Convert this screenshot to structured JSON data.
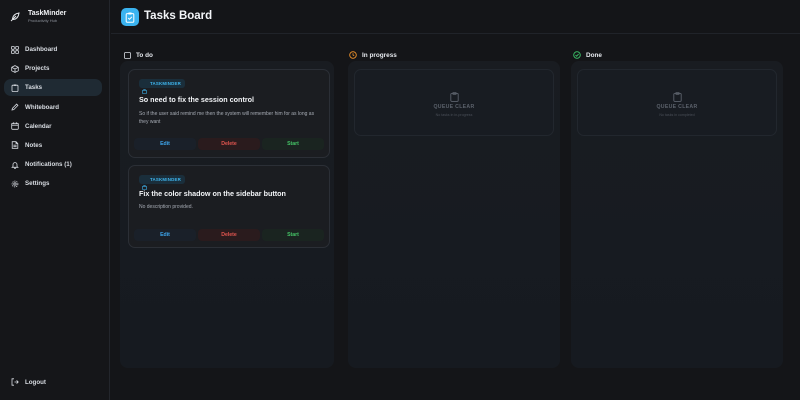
{
  "brand": {
    "name": "TaskMinder",
    "subtitle": "Productivity Hub",
    "logo_icon": "feather-icon"
  },
  "sidebar": {
    "items": [
      {
        "label": "Dashboard",
        "icon": "grid-icon"
      },
      {
        "label": "Projects",
        "icon": "box-icon"
      },
      {
        "label": "Tasks",
        "icon": "clipboard-icon",
        "active": true
      },
      {
        "label": "Whiteboard",
        "icon": "pencil-icon"
      },
      {
        "label": "Calendar",
        "icon": "calendar-icon"
      },
      {
        "label": "Notes",
        "icon": "note-icon"
      },
      {
        "label": "Notifications (1)",
        "icon": "bell-icon"
      },
      {
        "label": "Settings",
        "icon": "gear-icon"
      }
    ],
    "logout_label": "Logout"
  },
  "header": {
    "title": "Tasks Board",
    "icon": "clipboard-icon",
    "accent": "#3ab3ef"
  },
  "columns": {
    "todo": {
      "label": "To do",
      "icon": "square-icon",
      "tasks": [
        {
          "tag": "TASKMINDER",
          "title": "So need to fix the session control",
          "description": "So if the user said remind me then the system will remember him for as long as they want",
          "actions": {
            "edit": "Edit",
            "delete": "Delete",
            "start": "Start"
          }
        },
        {
          "tag": "TASKMINDER",
          "title": "Fix the color shadow on the sidebar button",
          "description": "No description provided.",
          "actions": {
            "edit": "Edit",
            "delete": "Delete",
            "start": "Start"
          }
        }
      ]
    },
    "in_progress": {
      "label": "In progress",
      "icon": "clock-icon",
      "color": "#f0932b",
      "empty_title": "QUEUE CLEAR",
      "empty_sub": "No tasks in in-progress"
    },
    "done": {
      "label": "Done",
      "icon": "check-circle-icon",
      "color": "#3cc46a",
      "empty_title": "QUEUE CLEAR",
      "empty_sub": "No tasks in completed"
    }
  },
  "colors": {
    "background": "#141518",
    "edit": "#3ea8f0",
    "delete": "#e0554f",
    "start": "#44c265"
  }
}
